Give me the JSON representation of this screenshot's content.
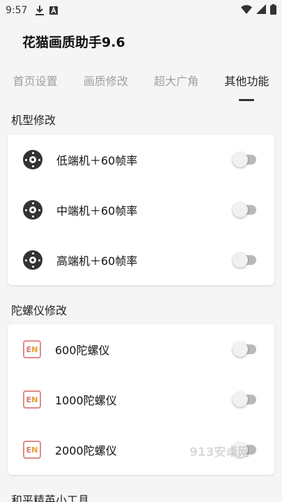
{
  "status_bar": {
    "time": "9:57",
    "icons_left": [
      "download-icon",
      "keyboard-a-icon"
    ],
    "icons_right": [
      "wifi-icon",
      "signal-icon",
      "battery-icon"
    ]
  },
  "app": {
    "title": "花猫画质助手9.6"
  },
  "tabs": [
    {
      "label": "首页设置",
      "active": false
    },
    {
      "label": "画质修改",
      "active": false
    },
    {
      "label": "超大广角",
      "active": false
    },
    {
      "label": "其他功能",
      "active": true
    }
  ],
  "sections": [
    {
      "title": "机型修改",
      "items": [
        {
          "label": "低端机＋60帧率",
          "icon": "camera-lens-icon",
          "enabled": false
        },
        {
          "label": "中端机＋60帧率",
          "icon": "camera-lens-icon",
          "enabled": false
        },
        {
          "label": "高端机＋60帧率",
          "icon": "camera-lens-icon",
          "enabled": false
        }
      ]
    },
    {
      "title": "陀螺仪修改",
      "items": [
        {
          "label": "600陀螺仪",
          "icon": "en-badge-icon",
          "enabled": false
        },
        {
          "label": "1000陀螺仪",
          "icon": "en-badge-icon",
          "enabled": false
        },
        {
          "label": "2000陀螺仪",
          "icon": "en-badge-icon",
          "enabled": false
        }
      ]
    },
    {
      "title": "和平精英小工具"
    }
  ],
  "watermark": "913安卓网",
  "colors": {
    "background": "#f5f5f5",
    "card": "#ffffff",
    "tab_inactive": "#9e9e9e",
    "tab_active": "#222222",
    "switch_track": "#b9b9b9"
  }
}
